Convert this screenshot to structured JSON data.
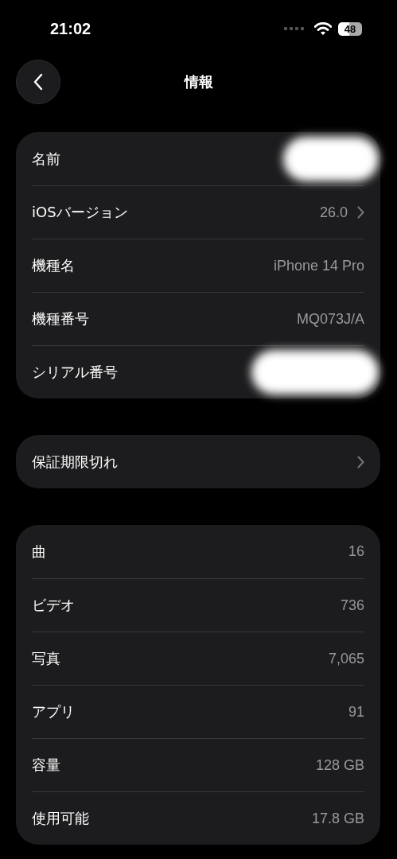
{
  "status_bar": {
    "time": "21:02",
    "battery": "48"
  },
  "nav": {
    "title": "情報"
  },
  "groups": [
    {
      "rows": [
        {
          "kind": "redacted",
          "label": "名前"
        },
        {
          "kind": "link",
          "label": "iOSバージョン",
          "value": "26.0"
        },
        {
          "kind": "value",
          "label": "機種名",
          "value": "iPhone 14 Pro"
        },
        {
          "kind": "value",
          "label": "機種番号",
          "value": "MQ073J/A"
        },
        {
          "kind": "redacted",
          "label": "シリアル番号"
        }
      ]
    },
    {
      "rows": [
        {
          "kind": "link",
          "label": "保証期限切れ"
        }
      ]
    },
    {
      "rows": [
        {
          "kind": "value",
          "label": "曲",
          "value": "16"
        },
        {
          "kind": "value",
          "label": "ビデオ",
          "value": "736"
        },
        {
          "kind": "value",
          "label": "写真",
          "value": "7,065"
        },
        {
          "kind": "value",
          "label": "アプリ",
          "value": "91"
        },
        {
          "kind": "value",
          "label": "容量",
          "value": "128 GB"
        },
        {
          "kind": "value",
          "label": "使用可能",
          "value": "17.8 GB"
        }
      ]
    }
  ]
}
